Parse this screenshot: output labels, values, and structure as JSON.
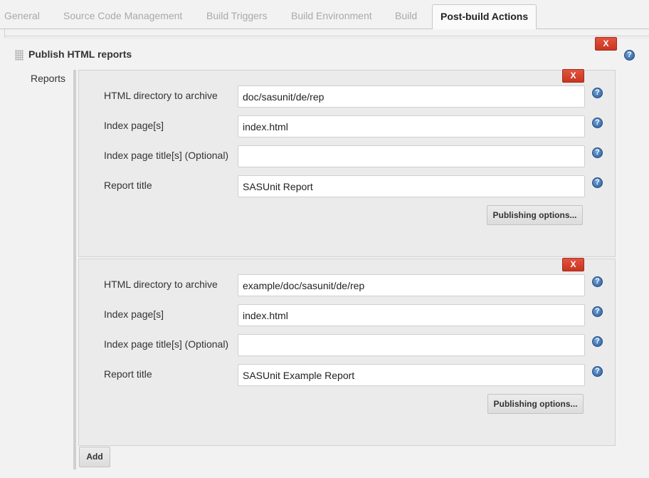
{
  "tabs": [
    {
      "label": "General",
      "active": false
    },
    {
      "label": "Source Code Management",
      "active": false
    },
    {
      "label": "Build Triggers",
      "active": false
    },
    {
      "label": "Build Environment",
      "active": false
    },
    {
      "label": "Build",
      "active": false
    },
    {
      "label": "Post-build Actions",
      "active": true
    }
  ],
  "section": {
    "title": "Publish HTML reports",
    "delete_label": "X",
    "help_label": "?",
    "reports_label": "Reports"
  },
  "fields": {
    "dir_label": "HTML directory to archive",
    "index_label": "Index page[s]",
    "index_title_label": "Index page title[s] (Optional)",
    "report_title_label": "Report title"
  },
  "reports": [
    {
      "html_directory": "doc/sasunit/de/rep",
      "index_pages": "index.html",
      "index_page_titles": "",
      "report_title": "SASUnit Report",
      "publishing_options_label": "Publishing options...",
      "delete_label": "X"
    },
    {
      "html_directory": "example/doc/sasunit/de/rep",
      "index_pages": "index.html",
      "index_page_titles": "",
      "report_title": "SASUnit Example Report",
      "publishing_options_label": "Publishing options...",
      "delete_label": "X"
    }
  ],
  "add_label": "Add",
  "colors": {
    "delete_red": "#d64430",
    "help_blue": "#2a5d9c",
    "panel_bg": "#ebebeb",
    "page_bg": "#f2f2f2"
  }
}
